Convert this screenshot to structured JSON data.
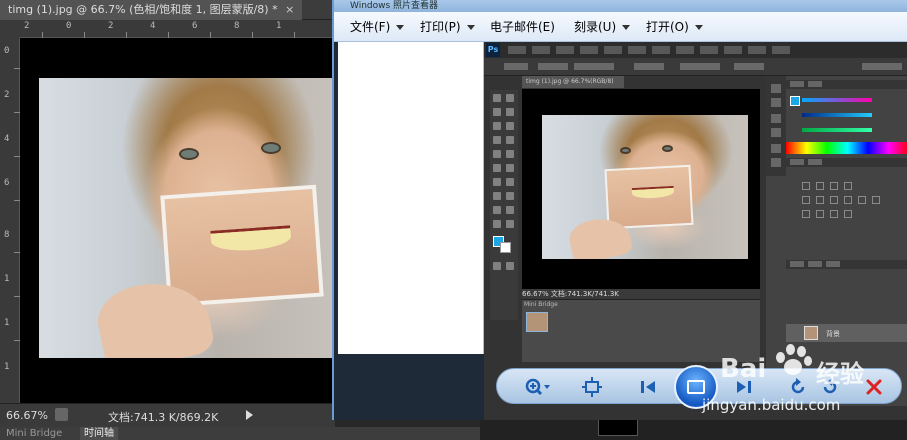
{
  "photoshop": {
    "document_tab": "timg (1).jpg @ 66.7% (色相/饱和度 1, 图层蒙版/8) *",
    "tab_close": "×",
    "ruler_top_labels": [
      "2",
      "0",
      "2",
      "4",
      "6",
      "8",
      "1"
    ],
    "ruler_left_labels": [
      "0",
      "2",
      "4",
      "6",
      "8",
      "1",
      "1",
      "1"
    ],
    "status": {
      "zoom": "66.67%",
      "doc_info": "文档:741.3 K/869.2K"
    },
    "bottom_tabs": [
      {
        "label": "Mini Bridge",
        "active": false
      },
      {
        "label": "时间轴",
        "active": true
      }
    ]
  },
  "viewer": {
    "title": "Windows 照片查看器",
    "menu": [
      {
        "label": "文件(F)"
      },
      {
        "label": "打印(P)"
      },
      {
        "label": "电子邮件(E)"
      },
      {
        "label": "刻录(U)"
      },
      {
        "label": "打开(O)"
      }
    ],
    "inner_ps": {
      "logo": "Ps",
      "doc_tab": "timg (1).jpg @ 66.7%(RGB/8)",
      "status": "66.67%    文档:741.3K/741.3K",
      "mini_bridge_tab": "Mini Bridge",
      "layer_name": "背景"
    },
    "toolbar_icons": [
      "zoom-icon",
      "actual-size-icon",
      "previous-icon",
      "slideshow-icon",
      "next-icon",
      "rotate-left-icon",
      "rotate-right-icon",
      "delete-icon"
    ]
  },
  "watermark": {
    "brand_left": "Bai",
    "brand_right": "经验",
    "url": "jingyan.baidu.com"
  },
  "colors": {
    "accent_blue": "#1ba6e6",
    "viewer_border": "#6b9bcf"
  }
}
